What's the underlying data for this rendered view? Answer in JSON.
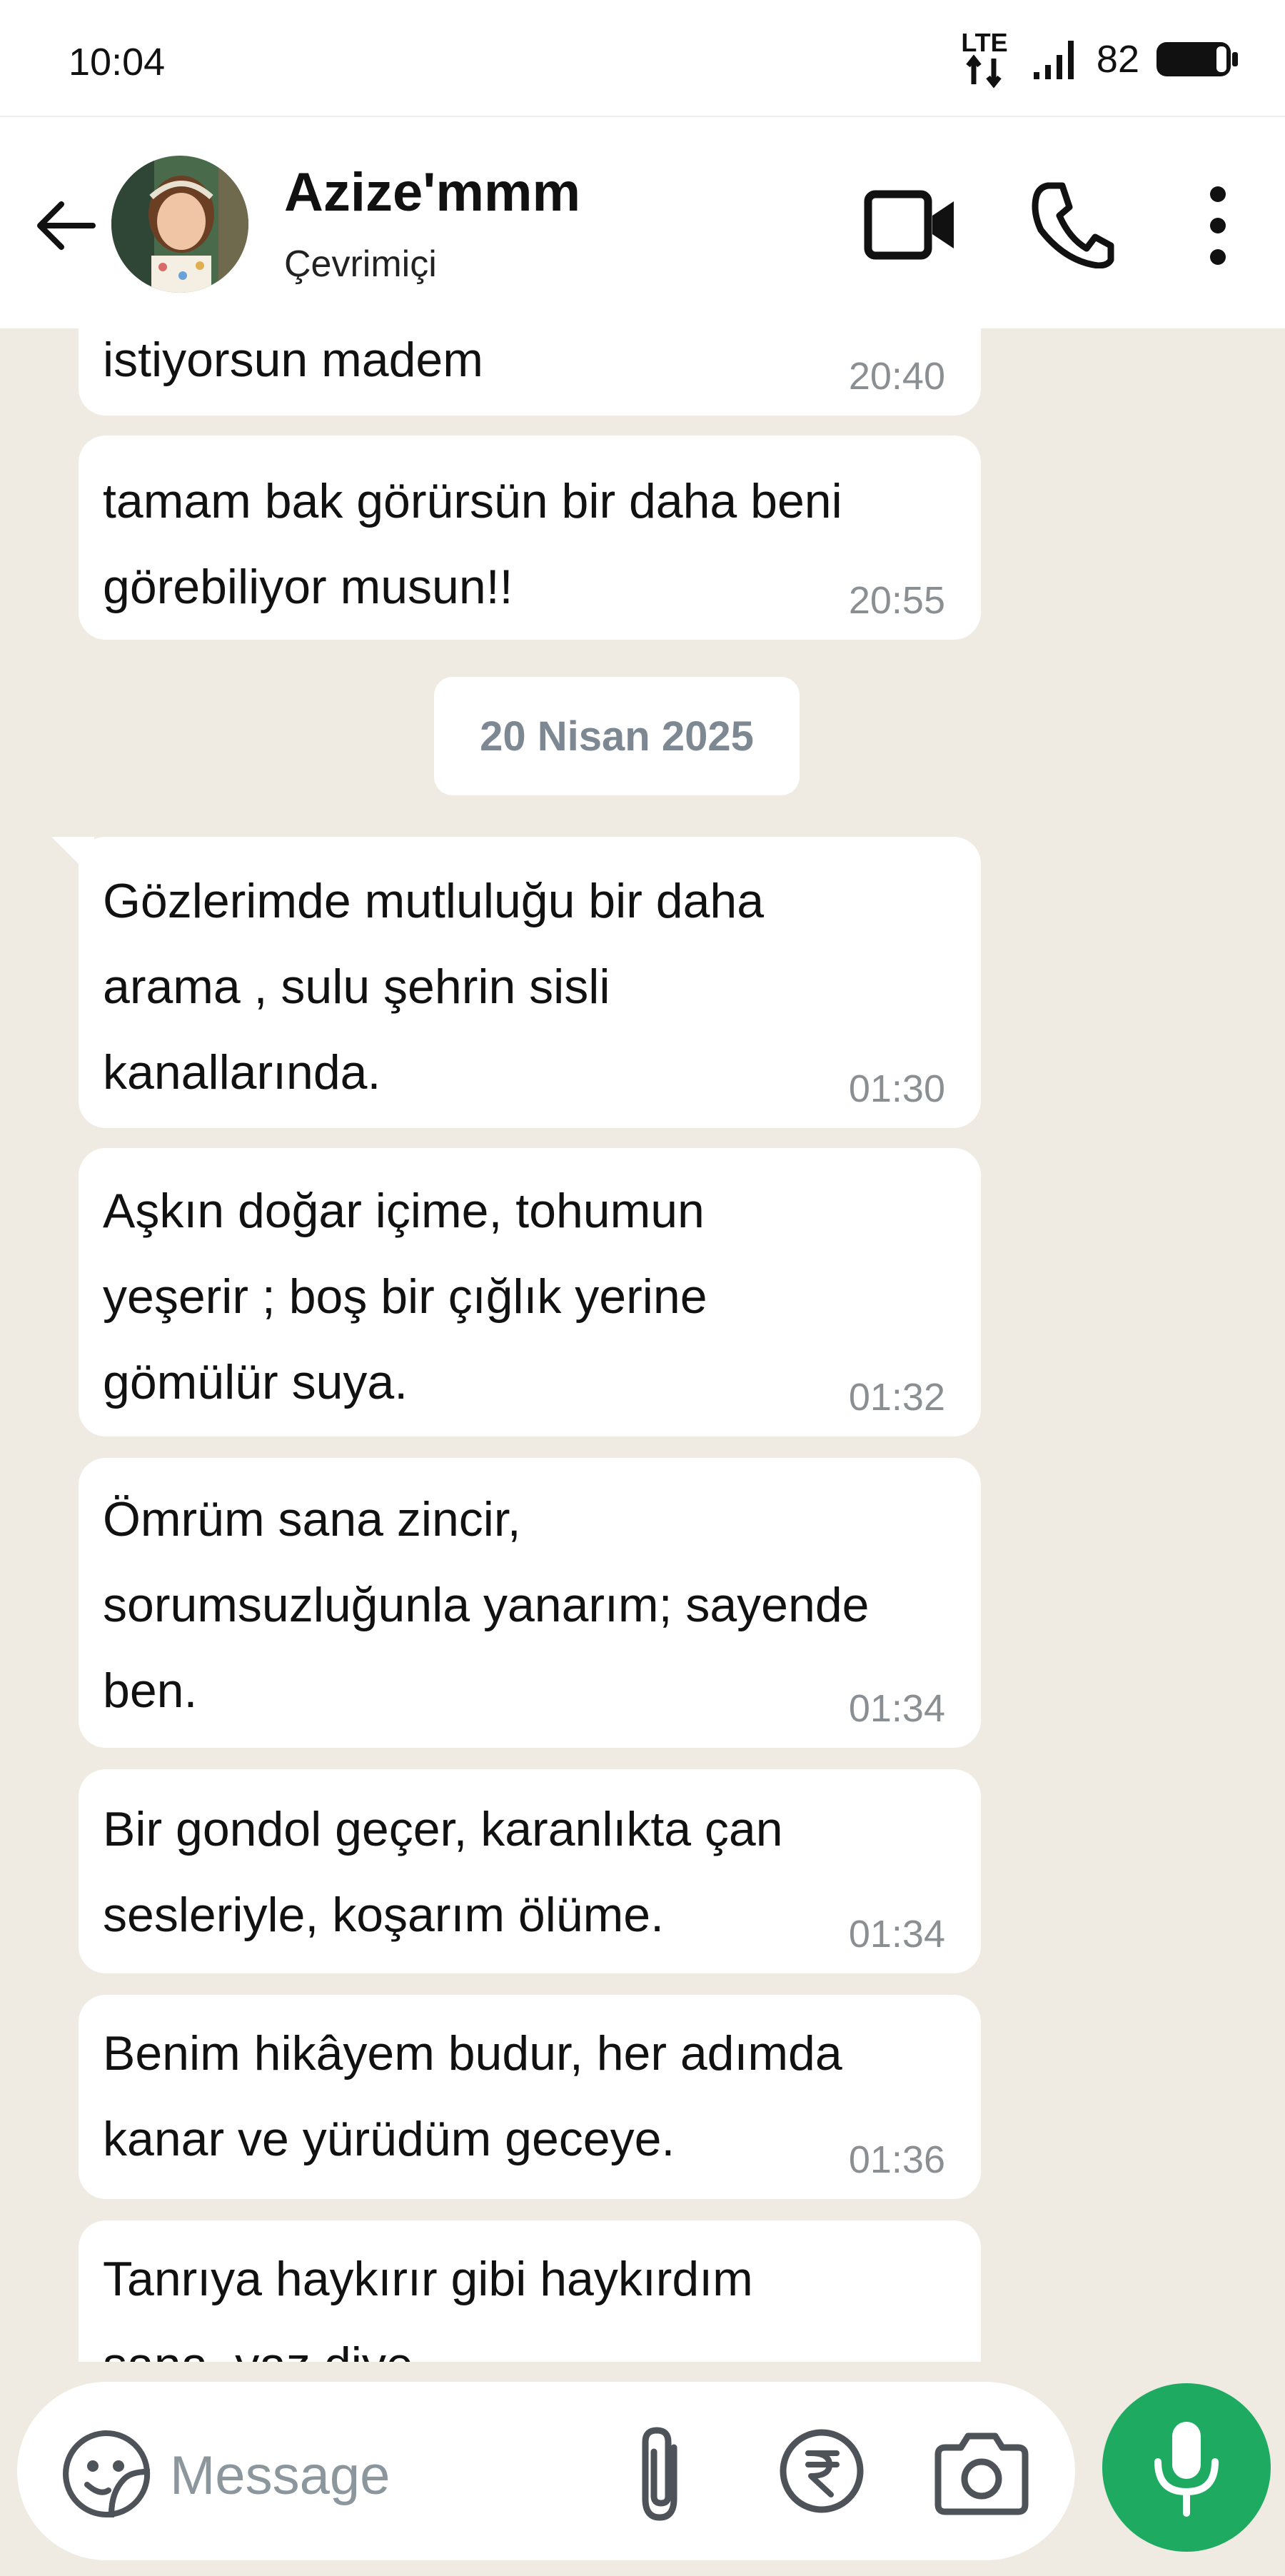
{
  "status_bar": {
    "time": "10:04",
    "network": "LTE",
    "battery": "82"
  },
  "header": {
    "name": "Azize'mmm",
    "status": "Çevrimiçi",
    "icons": [
      "back-arrow-icon",
      "video-call-icon",
      "phone-call-icon",
      "more-vert-icon"
    ]
  },
  "messages": [
    {
      "text": "istiyorsun madem",
      "time": "20:40"
    },
    {
      "text": " tamam bak görürsün bir daha beni\ngörebiliyor musun!!",
      "time": "20:55"
    },
    {
      "text": " Gözlerimde mutluluğu bir daha\narama , sulu şehrin sisli\nkanallarında.",
      "time": "01:30"
    },
    {
      "text": " Aşkın doğar içime, tohumun\nyeşerir ; boş bir çığlık yerine\ngömülür suya.",
      "time": "01:32"
    },
    {
      "text": " Ömrüm sana zincir,\nsorumsuzluğunla yanarım; sayende\nben.",
      "time": "01:34"
    },
    {
      "text": " Bir gondol geçer, karanlıkta çan\nsesleriyle, koşarım ölüme.",
      "time": "01:34"
    },
    {
      "text": " Benim hikâyem budur, her adımda\nkanar ve yürüdüm geceye.",
      "time": "01:36"
    },
    {
      "text": " Tanrıya haykırır gibi haykırdım\nsana, yaz diye",
      "time": ""
    }
  ],
  "date_separator": "20 Nisan 2025",
  "input": {
    "placeholder": "Message",
    "value": ""
  },
  "colors": {
    "accent": "#1eaa61",
    "chat_bg": "#efeae2",
    "bubble": "#ffffff",
    "timestamp": "#8a8f93"
  }
}
